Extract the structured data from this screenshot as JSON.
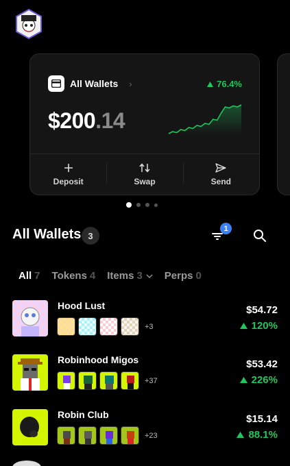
{
  "card": {
    "title": "All Wallets",
    "change_pct": "76.4%",
    "balance_main": "$200",
    "balance_decimal": ".14",
    "actions": [
      {
        "label": "Deposit",
        "icon": "plus-icon"
      },
      {
        "label": "Swap",
        "icon": "swap-icon"
      },
      {
        "label": "Send",
        "icon": "send-icon"
      }
    ],
    "sparkline": [
      2,
      3,
      2.5,
      4,
      3.5,
      5,
      4.5,
      6,
      5.5,
      7,
      6.5,
      9,
      8.5,
      12,
      15,
      14.5,
      15.5,
      15,
      16
    ]
  },
  "section": {
    "title": "All Wallets",
    "count": "3",
    "filter_badge": "1"
  },
  "tabs": [
    {
      "label": "All",
      "count": "7",
      "active": true
    },
    {
      "label": "Tokens",
      "count": "4"
    },
    {
      "label": "Items",
      "count": "3",
      "dropdown": true
    },
    {
      "label": "Perps",
      "count": "0"
    }
  ],
  "wallets": [
    {
      "name": "Hood Lust",
      "more": "+3",
      "value": "$54.72",
      "change": "120%"
    },
    {
      "name": "Robinhood Migos",
      "more": "+37",
      "value": "$53.42",
      "change": "226%"
    },
    {
      "name": "Robin Club",
      "more": "+23",
      "value": "$15.14",
      "change": "88.1%"
    }
  ],
  "colors": {
    "positive": "#22c55e",
    "accent_badge": "#3b82f6",
    "nft_lime": "#d4f500"
  }
}
